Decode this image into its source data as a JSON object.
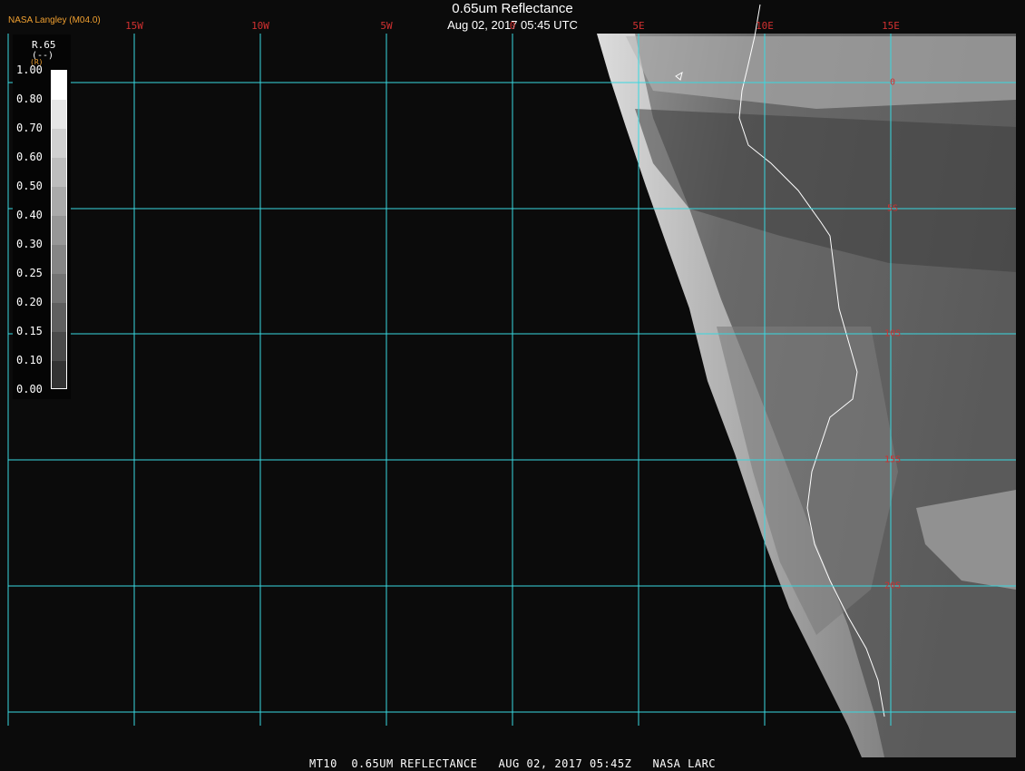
{
  "title": "0.65um Reflectance",
  "datetime": "Aug 02, 2017 05:45 UTC",
  "producer": "NASA Langley (M04.0)",
  "footer": "MT10  0.65UM REFLECTANCE   AUG 02, 2017 05:45Z   NASA LARC",
  "colors": {
    "grid": "#38d8e0",
    "label": "#d03030",
    "producer": "#f0a030",
    "coastline": "#ffffff",
    "background": "#0b0b0b"
  },
  "longitude_labels": [
    "15W",
    "10W",
    "5W",
    "0",
    "5E",
    "10E",
    "15E"
  ],
  "latitude_labels": [
    "0",
    "5S",
    "10S",
    "15S",
    "20S"
  ],
  "legend": {
    "name": "R.65",
    "units": "(--)",
    "marker": "(R)",
    "ticks": [
      "1.00",
      "0.80",
      "0.70",
      "0.60",
      "0.50",
      "0.40",
      "0.30",
      "0.25",
      "0.20",
      "0.15",
      "0.10",
      "0.00"
    ],
    "swatches": [
      "#ffffff",
      "#e6e6e6",
      "#d0d0d0",
      "#bdbdbd",
      "#aaaaaa",
      "#979797",
      "#858585",
      "#737373",
      "#5f5f5f",
      "#4a4a4a",
      "#333333"
    ]
  }
}
